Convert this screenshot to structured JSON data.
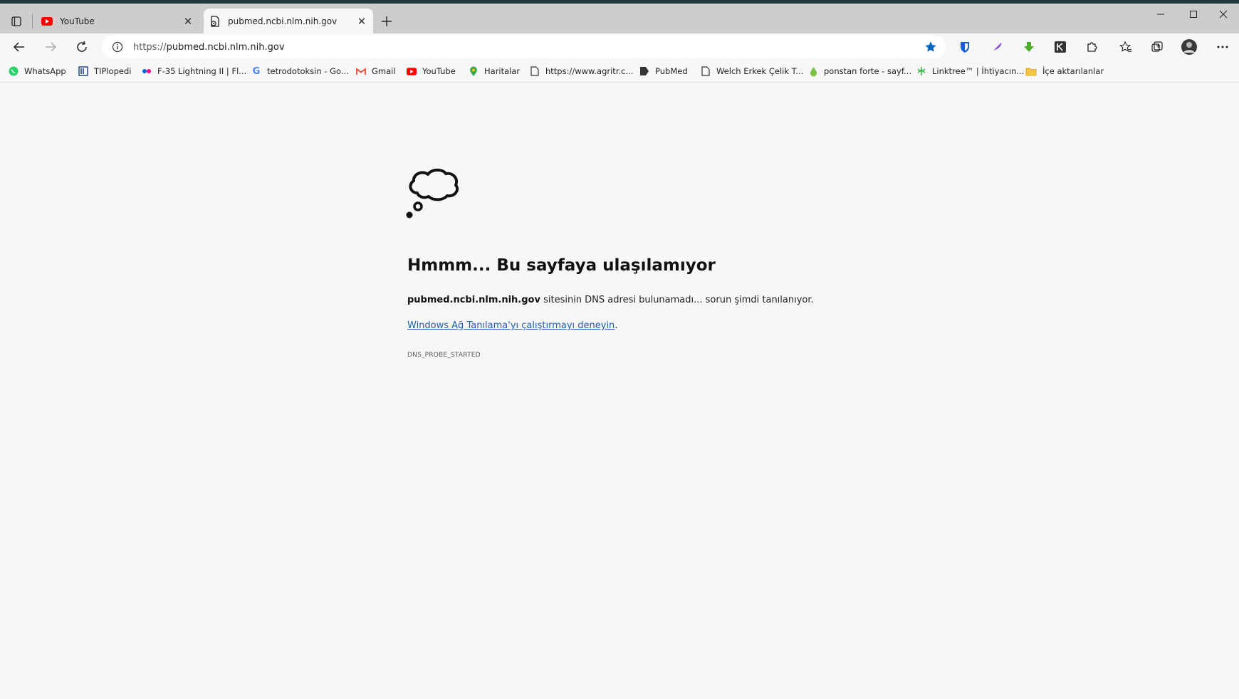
{
  "tabs": [
    {
      "title": "YouTube",
      "icon": "youtube-icon",
      "active": false
    },
    {
      "title": "pubmed.ncbi.nlm.nih.gov",
      "icon": "broken-page-icon",
      "active": true
    }
  ],
  "address": {
    "scheme": "https://",
    "host": "pubmed.ncbi.nlm.nih.gov"
  },
  "bookmarks": [
    {
      "label": "WhatsApp",
      "icon": "whatsapp-icon"
    },
    {
      "label": "TIPlopedi",
      "icon": "tiplopedi-icon"
    },
    {
      "label": "F-35 Lightning II | Fl...",
      "icon": "flickr-icon"
    },
    {
      "label": "tetrodotoksin - Go...",
      "icon": "google-icon"
    },
    {
      "label": "Gmail",
      "icon": "gmail-icon"
    },
    {
      "label": "YouTube",
      "icon": "youtube-icon"
    },
    {
      "label": "Haritalar",
      "icon": "maps-icon"
    },
    {
      "label": "https://www.agritr.c...",
      "icon": "page-icon"
    },
    {
      "label": "PubMed",
      "icon": "pubmed-icon"
    },
    {
      "label": "Welch Erkek Çelik T...",
      "icon": "page-icon"
    },
    {
      "label": "ponstan forte - sayf...",
      "icon": "drop-icon"
    },
    {
      "label": "Linktree™ | İhtiyacın...",
      "icon": "linktree-icon"
    },
    {
      "label": "İçe aktarılanlar",
      "icon": "folder-icon"
    }
  ],
  "error": {
    "title": "Hmmm... Bu sayfaya ulaşılamıyor",
    "host_bold": "pubmed.ncbi.nlm.nih.gov",
    "desc_rest": " sitesinin DNS adresi bulunamadı... sorun şimdi tanılanıyor.",
    "link_text": "Windows Ağ Tanılama'yı çalıştırmayı deneyin",
    "link_suffix": ".",
    "code": "DNS_PROBE_STARTED"
  },
  "colors": {
    "link": "#1a5fb4",
    "star": "#0067c0",
    "youtube": "#ff0000"
  }
}
